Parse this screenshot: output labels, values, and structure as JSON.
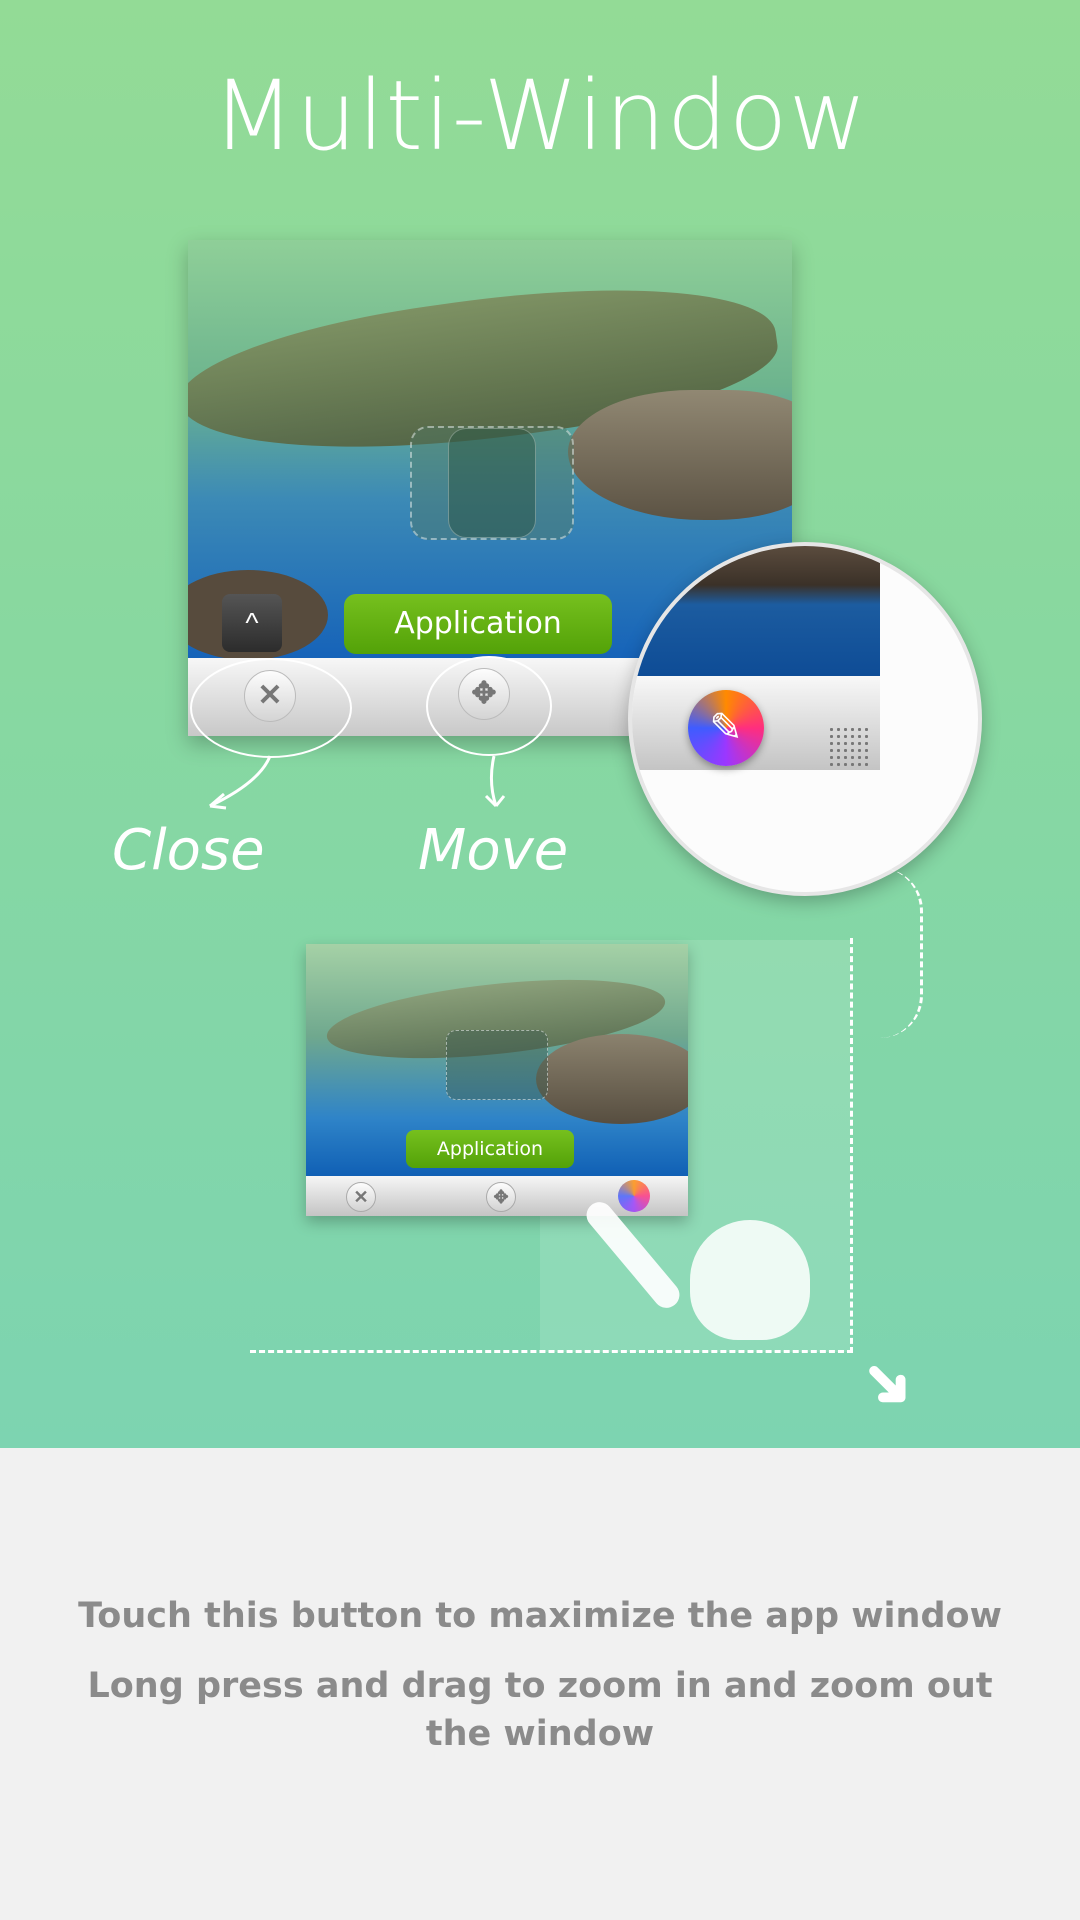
{
  "hero": {
    "title": "Multi-Window",
    "main_window": {
      "app_button_label": "Application",
      "close_icon": "✕",
      "move_icon": "✥",
      "expand_icon": "^"
    },
    "annotations": {
      "close_label": "Close",
      "move_label": "Move"
    },
    "magnifier": {
      "icon": "color-picker-icon"
    },
    "small_window": {
      "app_button_label": "Application"
    }
  },
  "instructions": {
    "line1": "Touch this button to maximize the app window",
    "line2": "Long press and drag to zoom in and zoom out the window"
  },
  "colors": {
    "hero_top": "#93db96",
    "hero_bottom": "#7dd4b1",
    "app_button": "#5fb011",
    "text_gray": "#8b8b8b",
    "footer_bg": "#f1f1f1"
  }
}
